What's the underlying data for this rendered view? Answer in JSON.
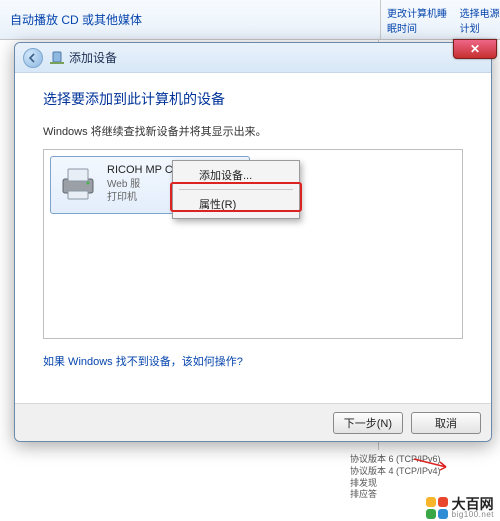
{
  "bg": {
    "top_link": "自动播放 CD 或其他媒体",
    "right_link1": "更改计算机睡眠时间",
    "right_link2": "选择电源计划",
    "bottom_lines": [
      "协议版本 6 (TCP/IPv6)",
      "协议版本 4 (TCP/IPv4)",
      "排发现",
      "排应答"
    ]
  },
  "wizard": {
    "title": "添加设备",
    "close_glyph": "✕",
    "heading": "选择要添加到此计算机的设备",
    "subtext": "Windows 将继续查找新设备并将其显示出来。",
    "device": {
      "name": "RICOH MP C3503",
      "line2": "Web 服",
      "line3": "打印机"
    },
    "context_menu": {
      "item1": "添加设备...",
      "item2": "属性(R)"
    },
    "help_link": "如果 Windows 找不到设备，该如何操作?",
    "next_btn": "下一步(N)",
    "cancel_btn": "取消"
  },
  "watermark": {
    "name": "大百网",
    "domain": "big100.net",
    "colors": {
      "a": "#f7b52c",
      "b": "#e8462d",
      "c": "#3aa746",
      "d": "#2f8dd6"
    }
  }
}
